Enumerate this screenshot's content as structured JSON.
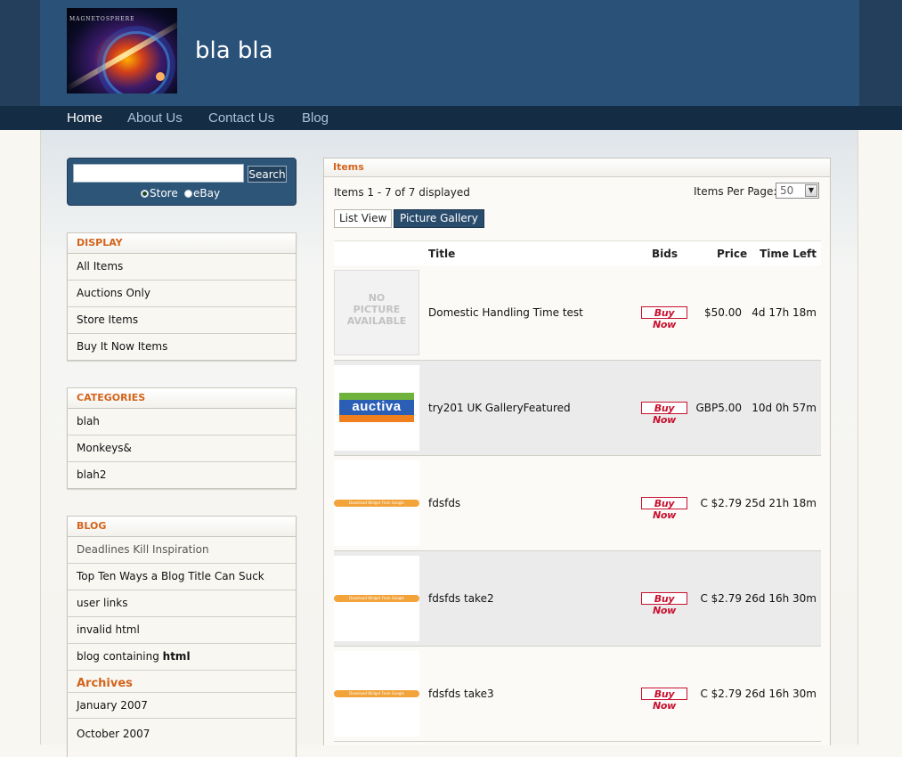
{
  "site": {
    "logo_caption": "MAGNETOSPHERE",
    "title": "bla bla"
  },
  "nav": {
    "items": [
      {
        "label": "Home",
        "active": true
      },
      {
        "label": "About Us",
        "active": false
      },
      {
        "label": "Contact Us",
        "active": false
      },
      {
        "label": "Blog",
        "active": false
      }
    ]
  },
  "search": {
    "value": "",
    "button_label": "Search",
    "options": [
      {
        "label": "Store",
        "checked": true
      },
      {
        "label": "eBay",
        "checked": false
      }
    ]
  },
  "sidebar": {
    "display": {
      "heading": "DISPLAY",
      "items": [
        "All Items",
        "Auctions Only",
        "Store Items",
        "Buy It Now Items"
      ]
    },
    "categories": {
      "heading": "CATEGORIES",
      "items": [
        "blah",
        "Monkeys&",
        "blah2"
      ]
    },
    "blog": {
      "heading": "BLOG",
      "items": [
        "Deadlines Kill Inspiration",
        "Top Ten Ways a Blog Title Can Suck",
        "user links",
        "invalid html",
        "blog containing"
      ],
      "item_bold_suffix": "html",
      "archives_heading": "Archives",
      "archives": [
        "January 2007",
        "October 2007"
      ]
    }
  },
  "main": {
    "heading": "Items",
    "count_text": "Items 1 - 7 of 7 displayed",
    "items_per_page_label": "Items Per Page:",
    "items_per_page_value": "50",
    "views": {
      "list": "List View",
      "gallery": "Picture Gallery"
    },
    "columns": {
      "title": "Title",
      "bids": "Bids",
      "price": "Price",
      "time_left": "Time Left"
    },
    "buy_now_label": "Buy Now",
    "no_picture_text": [
      "NO",
      "PICTURE",
      "AVAILABLE"
    ],
    "auctiva_text": "auctiva",
    "widget_text": "Download Widget From Google",
    "rows": [
      {
        "title": "Domestic Handling Time test",
        "price": "$50.00",
        "time_left": "4d 17h 18m",
        "thumb": "no-picture"
      },
      {
        "title": "try201 UK GalleryFeatured",
        "price": "GBP5.00",
        "time_left": "10d 0h 57m",
        "thumb": "auctiva"
      },
      {
        "title": "fdsfds",
        "price": "C $2.79",
        "time_left": "25d 21h 18m",
        "thumb": "widget"
      },
      {
        "title": "fdsfds take2",
        "price": "C $2.79",
        "time_left": "26d 16h 30m",
        "thumb": "widget"
      },
      {
        "title": "fdsfds take3",
        "price": "C $2.79",
        "time_left": "26d 16h 30m",
        "thumb": "widget"
      }
    ]
  },
  "colors": {
    "header": "#2a5178",
    "nav": "#142d44",
    "accent_orange": "#d4641c",
    "buy_now_red": "#c8102e"
  }
}
